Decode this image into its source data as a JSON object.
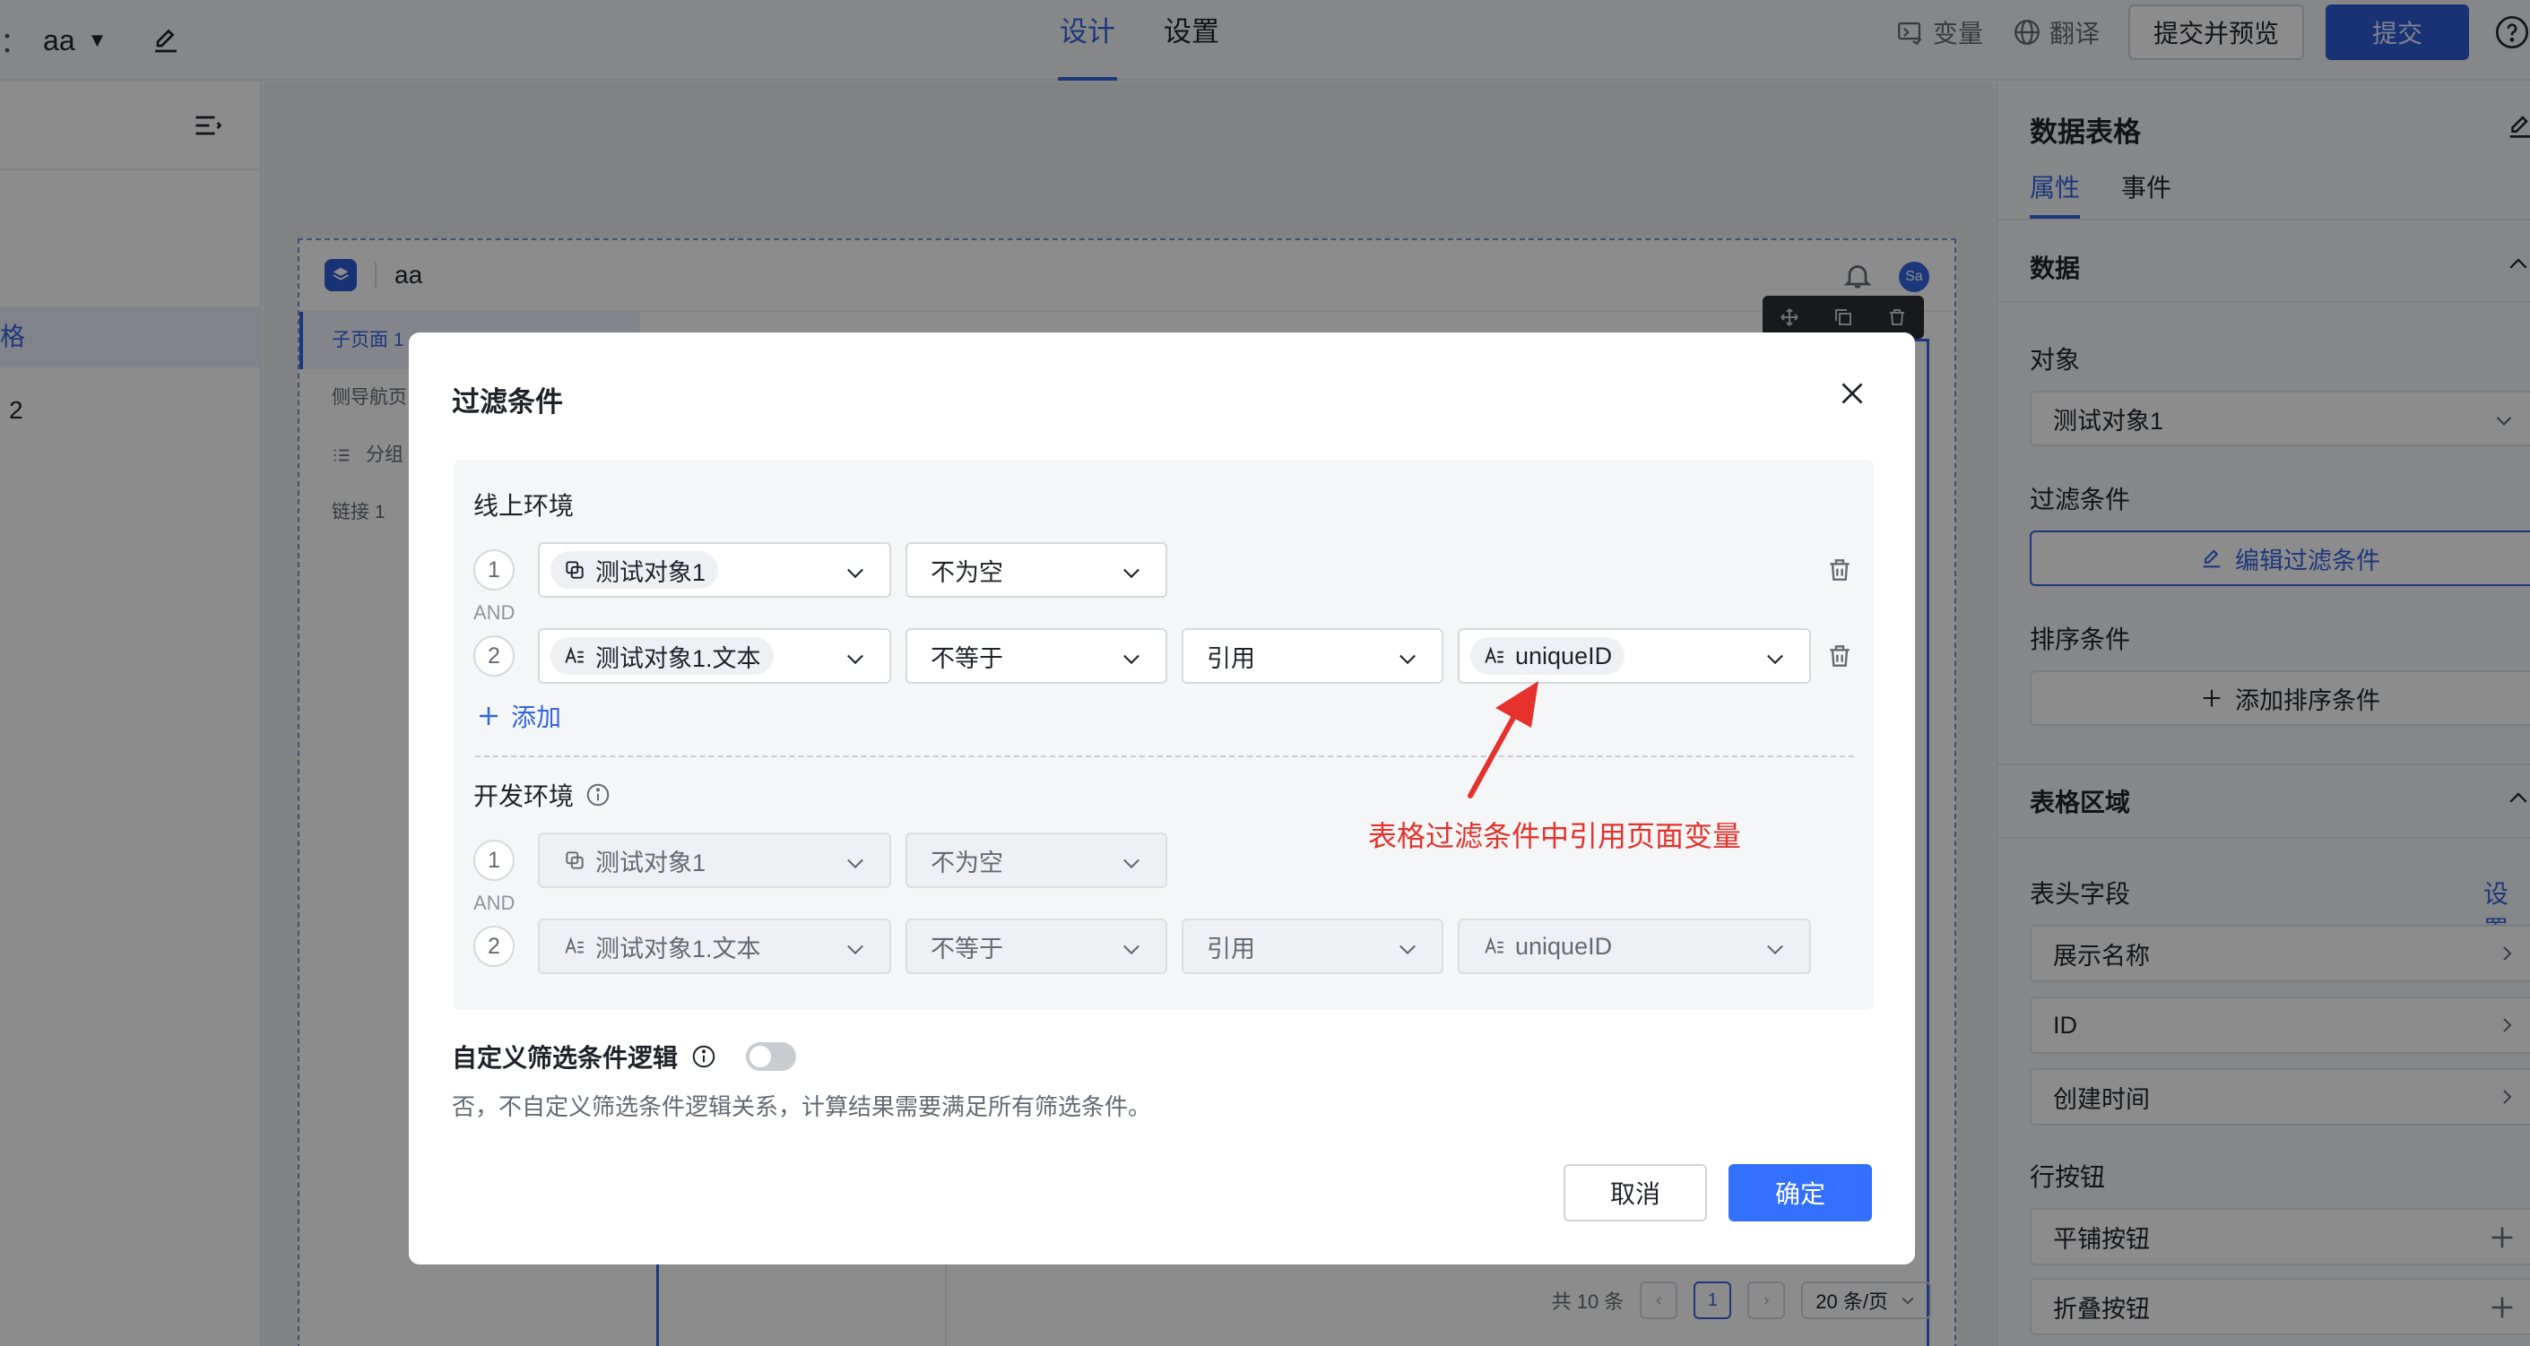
{
  "topbar": {
    "app_prefix": "：",
    "app_name": "aa",
    "tabs": [
      {
        "label": "设计",
        "active": true
      },
      {
        "label": "设置",
        "active": false
      }
    ],
    "variables_label": "变量",
    "translate_label": "翻译",
    "preview_label": "提交并预览",
    "submit_label": "提交"
  },
  "left_panel": {
    "selected_item": "格",
    "item_two": "2"
  },
  "canvas": {
    "app_title": "aa",
    "avatar_text": "Sa",
    "nav": [
      {
        "label": "子页面 1",
        "active": true
      },
      {
        "label": "侧导航页",
        "active": false
      },
      {
        "label": "分组",
        "active": false
      },
      {
        "label": "链接 1",
        "active": false
      }
    ],
    "pagination": {
      "total": "共 10 条",
      "page": "1",
      "page_size": "20 条/页"
    }
  },
  "right_panel": {
    "title": "数据表格",
    "tabs": [
      {
        "label": "属性",
        "active": true
      },
      {
        "label": "事件",
        "active": false
      }
    ],
    "data_section": "数据",
    "object_label": "对象",
    "object_value": "测试对象1",
    "filter_label": "过滤条件",
    "edit_filter_btn": "编辑过滤条件",
    "sort_label": "排序条件",
    "add_sort_btn": "添加排序条件",
    "table_area_section": "表格区域",
    "header_fields_label": "表头字段",
    "settings_link": "设置",
    "fields": [
      "展示名称",
      "ID",
      "创建时间"
    ],
    "row_buttons_label": "行按钮",
    "row_buttons": [
      "平铺按钮",
      "折叠按钮"
    ]
  },
  "modal": {
    "title": "过滤条件",
    "online_env": {
      "label": "线上环境",
      "rows": [
        {
          "num": "1",
          "field": "测试对象1",
          "operator": "不为空"
        },
        {
          "num": "2",
          "field": "测试对象1.文本",
          "operator": "不等于",
          "value_type": "引用",
          "value": "uniqueID"
        }
      ],
      "and_label": "AND",
      "add_label": "添加"
    },
    "dev_env": {
      "label": "开发环境",
      "rows": [
        {
          "num": "1",
          "field": "测试对象1",
          "operator": "不为空"
        },
        {
          "num": "2",
          "field": "测试对象1.文本",
          "operator": "不等于",
          "value_type": "引用",
          "value": "uniqueID"
        }
      ],
      "and_label": "AND"
    },
    "custom_logic_label": "自定义筛选条件逻辑",
    "custom_logic_enabled": false,
    "custom_logic_desc": "否，不自定义筛选条件逻辑关系，计算结果需要满足所有筛选条件。",
    "cancel_label": "取消",
    "confirm_label": "确定"
  },
  "annotation": {
    "text": "表格过滤条件中引用页面变量",
    "color": "#e5322d"
  },
  "colors": {
    "primary": "#3464e0",
    "submit": "#2e5bd7",
    "confirm": "#3370ff"
  }
}
